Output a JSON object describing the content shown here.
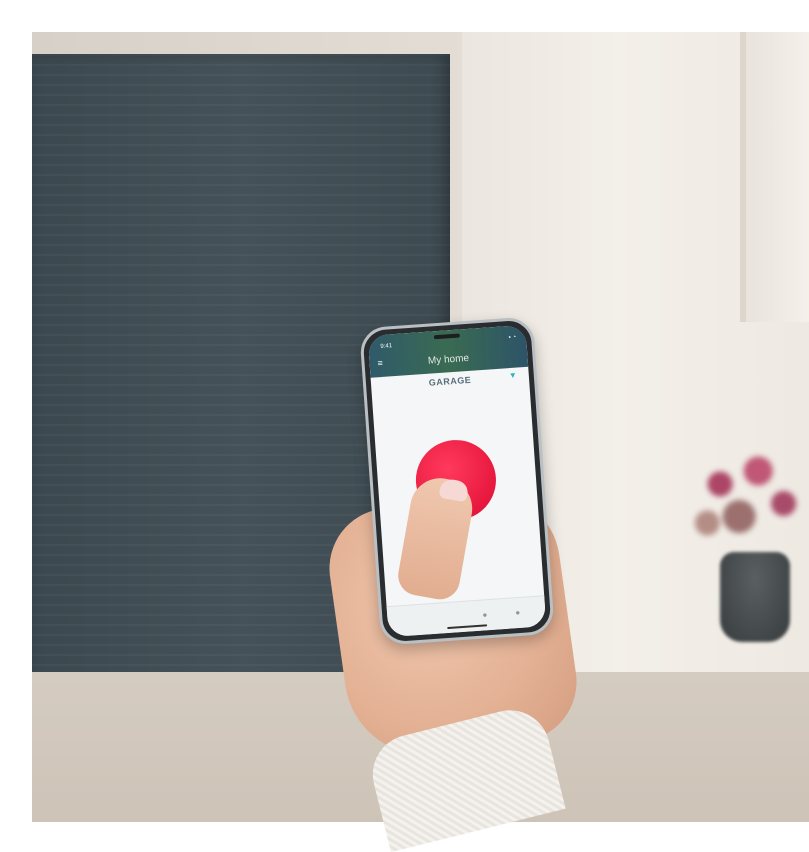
{
  "phone": {
    "status_time": "9:41",
    "status_icons": "▪ ◔",
    "menu_icon": "≡",
    "app_title": "My home",
    "device_label": "GARAGE",
    "wifi_icon": "▼",
    "user_icon": "●",
    "settings_icon": "●"
  },
  "colors": {
    "garage_door": "#414e55",
    "button_red": "#e8183f",
    "header_teal": "#2f5a6a"
  }
}
